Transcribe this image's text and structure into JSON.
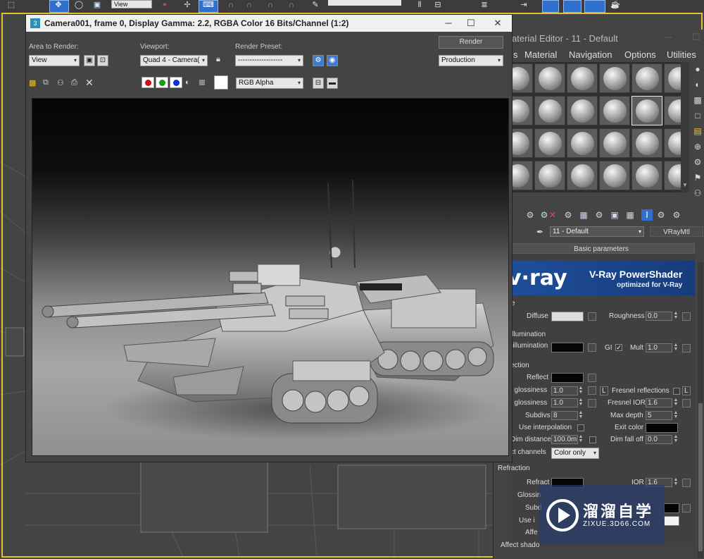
{
  "toolbar": {
    "view_dropdown": "View"
  },
  "render_window": {
    "title": "Camera001, frame 0, Display Gamma: 2.2, RGBA Color 16 Bits/Channel (1:2)",
    "area_label": "Area to Render:",
    "area_value": "View",
    "viewport_label": "Viewport:",
    "viewport_value": "Quad 4 - Camera(",
    "preset_label": "Render Preset:",
    "preset_value": "-------------------",
    "render_button": "Render",
    "mode_value": "Production",
    "channel_value": "RGB Alpha"
  },
  "material_editor": {
    "title": "aterial Editor - 11 - Default",
    "menus": [
      "s",
      "Material",
      "Navigation",
      "Options",
      "Utilities"
    ],
    "material_name": "11 - Default",
    "material_type": "VRayMtl",
    "basic_parameters": "Basic parameters",
    "vray_logo": "v·ray",
    "vray_title": "V-Ray PowerShader",
    "vray_subtitle": "optimized for V-Ray",
    "diffuse_group": "se",
    "diffuse_label": "Diffuse",
    "roughness_label": "Roughness",
    "roughness_value": "0.0",
    "selfillum_group": "illumination",
    "selfillum_label": "-illumination",
    "gi_label": "GI",
    "mult_label": "Mult",
    "mult_value": "1.0",
    "reflection_group": "ection",
    "reflect_label": "Reflect",
    "hl_gloss_label": "t glossiness",
    "hl_gloss_value": "1.0",
    "l_label": "L",
    "fresnel_label": "Fresnel reflections",
    "fresnel_l": "L",
    "refl_gloss_label": ". glossiness",
    "refl_gloss_value": "1.0",
    "fresnel_ior_label": "Fresnel IOR",
    "fresnel_ior_value": "1.6",
    "subdivs_label": "Subdivs",
    "subdivs_value": "8",
    "max_depth_label": "Max depth",
    "max_depth_value": "5",
    "use_interp_label": "Use interpolation",
    "exit_color_label": "Exit color",
    "dim_dist_label": "Dim distance",
    "dim_dist_value": "100.0m",
    "dim_falloff_label": "Dim fall off",
    "dim_falloff_value": "0.0",
    "affect_channels_label": "ct channels",
    "affect_channels_value": "Color only",
    "refraction_group": "Refraction",
    "refract_label": "Refract",
    "ior_label": "IOR",
    "ior_value": "1.6",
    "glossiness_label": "Glossin",
    "subdivs2_label": "Subd",
    "use_interp2_label": "Use i",
    "affect2_label": "Affe",
    "affect_shadows_label": "Affect shado"
  },
  "watermark": {
    "line1": "溜溜自学",
    "line2": "ZIXUE.3D66.COM"
  },
  "colors": {
    "toolbar_active": "#2f6fd0",
    "vray_blue": "#1f4e9a",
    "selection_yellow": "#e5c130"
  }
}
